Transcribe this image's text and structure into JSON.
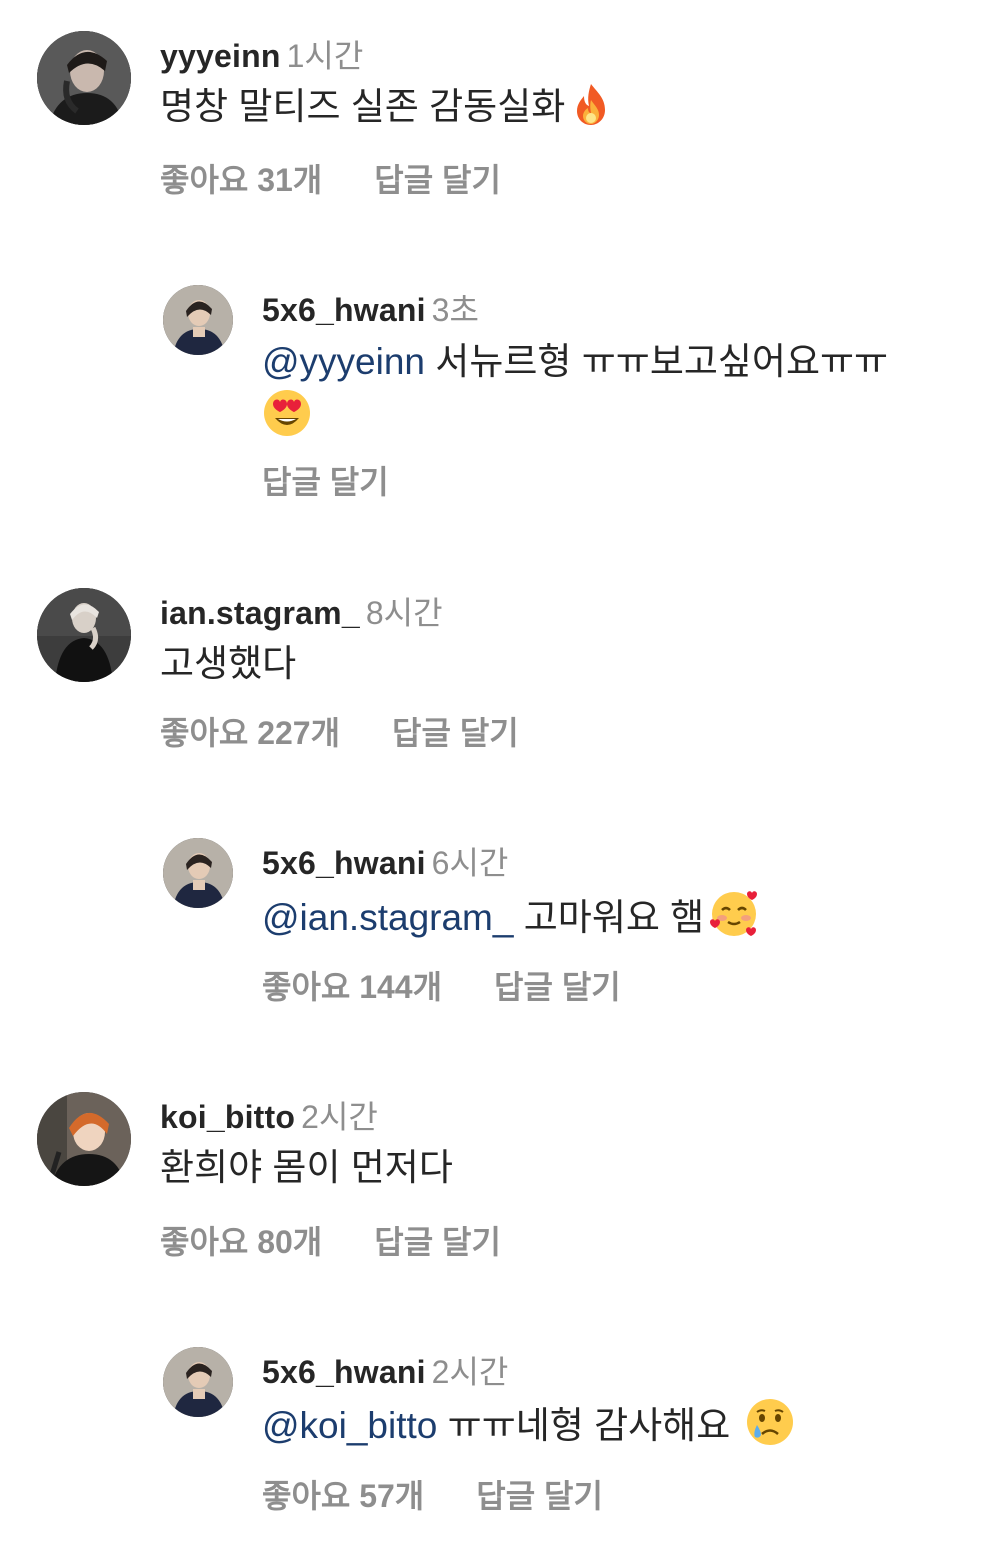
{
  "comments": [
    {
      "username": "yyyeinn",
      "time": "1시간",
      "text": "명창 말티즈 실존 감동실화",
      "emoji": "fire-emoji",
      "likes": "좋아요 31개",
      "reply": "답글 달기"
    },
    {
      "username": "5x6_hwani",
      "time": "3초",
      "mention": "@yyyeinn",
      "text": " 서뉴르형 ㅠㅠ보고싶어요ㅠㅠ",
      "emoji": "heart-eyes-emoji",
      "reply": "답글 달기"
    },
    {
      "username": "ian.stagram_",
      "time": "8시간",
      "text": "고생했다",
      "likes": "좋아요 227개",
      "reply": "답글 달기"
    },
    {
      "username": "5x6_hwani",
      "time": "6시간",
      "mention": "@ian.stagram_",
      "text": " 고마워요 햄",
      "emoji": "smiling-hearts-emoji",
      "likes": "좋아요 144개",
      "reply": "답글 달기"
    },
    {
      "username": "koi_bitto",
      "time": "2시간",
      "text": "환희야 몸이 먼저다",
      "likes": "좋아요 80개",
      "reply": "답글 달기"
    },
    {
      "username": "5x6_hwani",
      "time": "2시간",
      "mention": "@koi_bitto",
      "text": " ㅠㅠ네형 감사해요 ",
      "emoji": "crying-face-emoji",
      "likes": "좋아요 57개",
      "reply": "답글 달기"
    }
  ]
}
